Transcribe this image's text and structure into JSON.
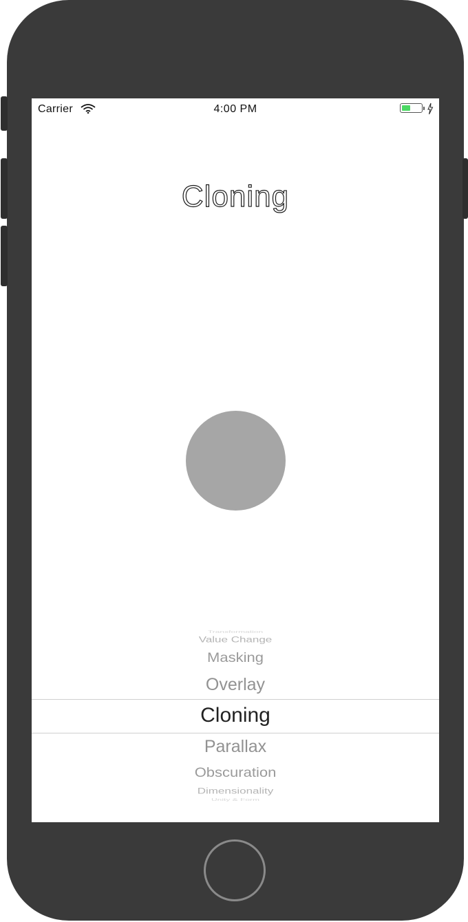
{
  "status_bar": {
    "carrier": "Carrier",
    "time": "4:00 PM",
    "battery_color": "#4cd964"
  },
  "title": "Cloning",
  "circle_color": "#a6a6a6",
  "picker": {
    "items_above": [
      "Transformation",
      "Value Change",
      "Masking",
      "Overlay"
    ],
    "selected": "Cloning",
    "items_below": [
      "Parallax",
      "Obscuration",
      "Dimensionality",
      "Unity & Form"
    ]
  },
  "icons": [
    "wifi-icon",
    "battery-icon",
    "charging-bolt-icon",
    "home-button"
  ]
}
